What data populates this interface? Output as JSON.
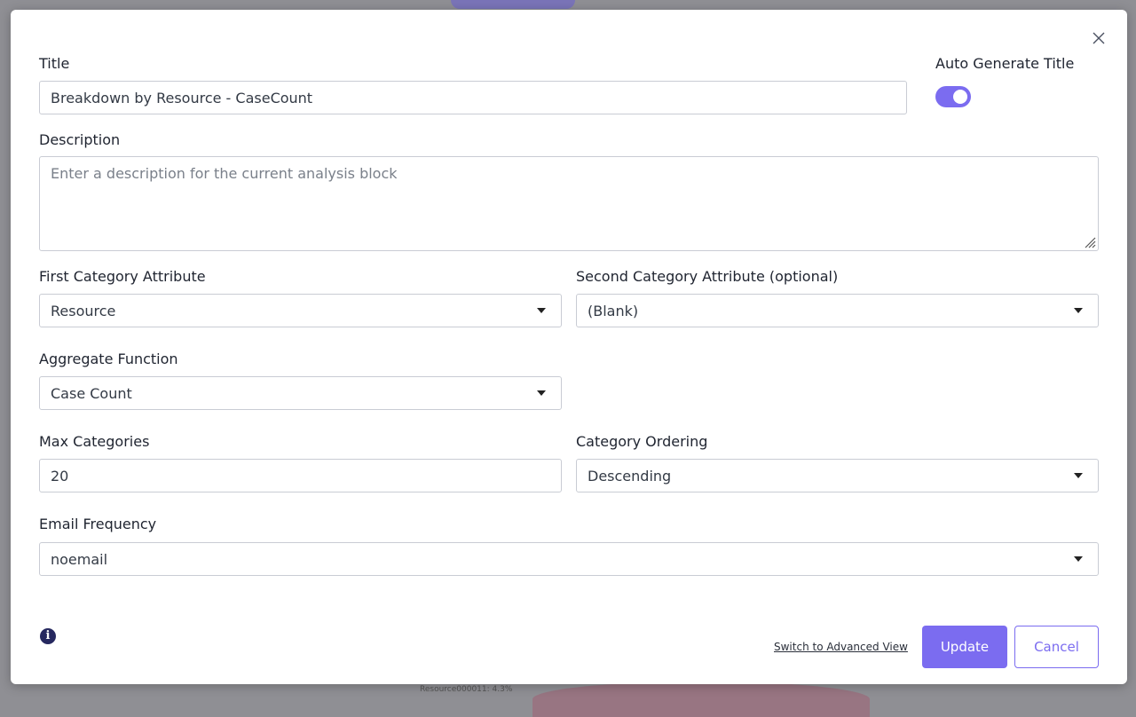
{
  "background": {
    "chart_label": "Resource000011: 4.3%"
  },
  "modal": {
    "close_icon": "close-icon",
    "title": {
      "label": "Title",
      "value": "Breakdown by Resource - CaseCount"
    },
    "auto_generate": {
      "label": "Auto Generate Title",
      "enabled": true
    },
    "description": {
      "label": "Description",
      "placeholder": "Enter a description for the current analysis block",
      "value": ""
    },
    "first_category": {
      "label": "First Category Attribute",
      "value": "Resource"
    },
    "second_category": {
      "label": "Second Category Attribute (optional)",
      "value": "(Blank)"
    },
    "aggregate": {
      "label": "Aggregate Function",
      "value": "Case Count"
    },
    "max_categories": {
      "label": "Max Categories",
      "value": "20"
    },
    "ordering": {
      "label": "Category Ordering",
      "value": "Descending"
    },
    "email": {
      "label": "Email Frequency",
      "value": "noemail"
    },
    "footer": {
      "info_icon": "info-icon",
      "info_glyph": "i",
      "advanced_link": "Switch to Advanced View",
      "update": "Update",
      "cancel": "Cancel"
    }
  },
  "colors": {
    "accent": "#7b6cf0",
    "info": "#26285f",
    "overlay": "#8f8f94"
  }
}
